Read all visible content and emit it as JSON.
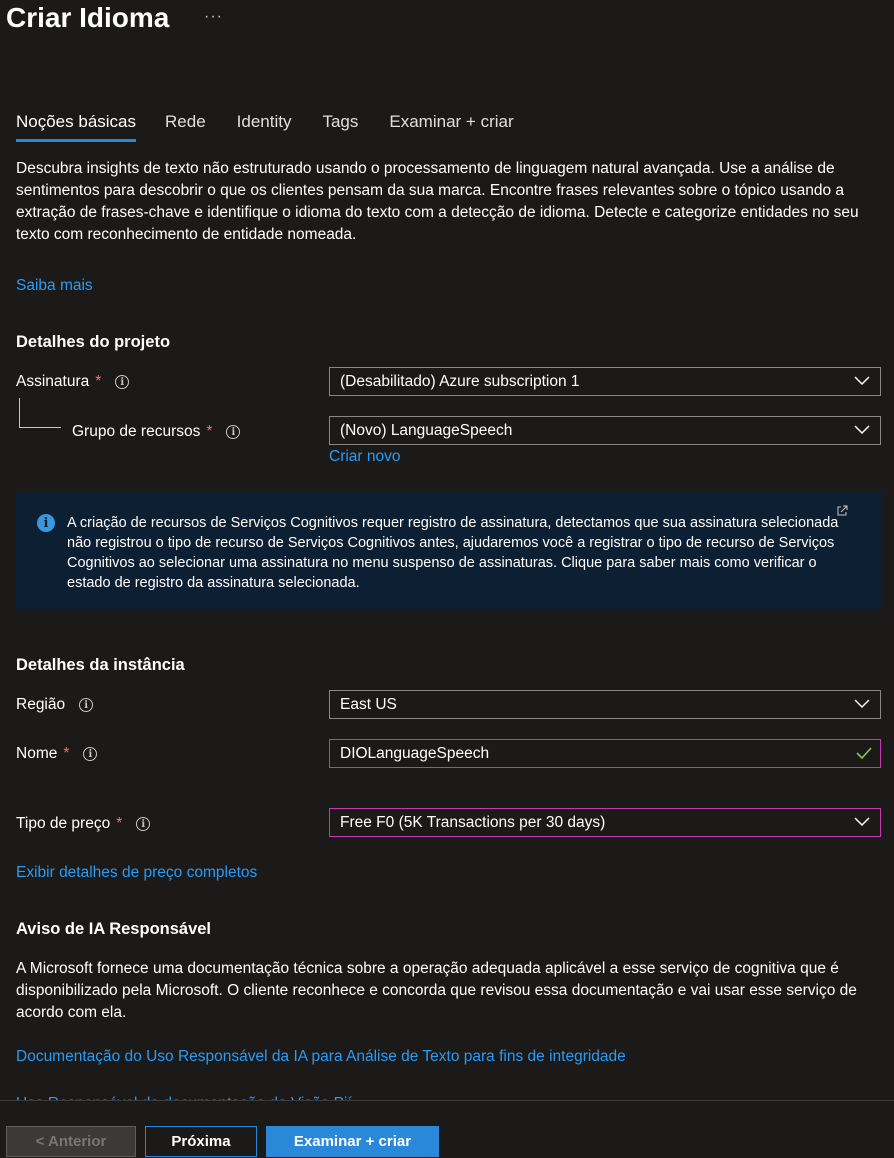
{
  "page": {
    "title": "Criar Idioma",
    "more_label": "···"
  },
  "tabs": [
    {
      "label": "Noções básicas",
      "active": true
    },
    {
      "label": "Rede",
      "active": false
    },
    {
      "label": "Identity",
      "active": false
    },
    {
      "label": "Tags",
      "active": false
    },
    {
      "label": "Examinar + criar",
      "active": false
    }
  ],
  "intro": {
    "text": "Descubra insights de texto não estruturado usando o processamento de linguagem natural avançada. Use a análise de sentimentos para descobrir o que os clientes pensam da sua marca. Encontre frases relevantes sobre o tópico usando a extração de frases-chave e identifique o idioma do texto com a detecção de idioma. Detecte e categorize entidades no seu texto com reconhecimento de entidade nomeada.",
    "learn_more": "Saiba mais"
  },
  "project": {
    "heading": "Detalhes do projeto",
    "subscription": {
      "label": "Assinatura",
      "required": "*",
      "value": "(Desabilitado) Azure subscription 1"
    },
    "resource_group": {
      "label": "Grupo de recursos",
      "required": "*",
      "value": "(Novo) LanguageSpeech",
      "create_new": "Criar novo"
    }
  },
  "banner": {
    "text": "A criação de recursos de Serviços Cognitivos requer registro de assinatura, detectamos que sua assinatura selecionada não registrou o tipo de recurso de Serviços Cognitivos antes, ajudaremos você a registrar o tipo de recurso de Serviços Cognitivos ao selecionar uma assinatura no menu suspenso de assinaturas. Clique para saber mais como verificar o estado de registro da assinatura selecionada."
  },
  "instance": {
    "heading": "Detalhes da instância",
    "region": {
      "label": "Região",
      "value": "East US"
    },
    "name": {
      "label": "Nome",
      "required": "*",
      "value": "DIOLanguageSpeech"
    },
    "pricing": {
      "label": "Tipo de preço",
      "required": "*",
      "value": "Free F0 (5K Transactions per 30 days)"
    },
    "pricing_link": "Exibir detalhes de preço completos"
  },
  "responsible_ai": {
    "heading": "Aviso de IA Responsável",
    "text": "A Microsoft fornece uma documentação técnica sobre a operação adequada aplicável a esse serviço de cognitiva que é disponibilizado pela Microsoft. O cliente reconhece e concorda que revisou essa documentação e vai usar esse serviço de acordo com ela.",
    "doc_link": "Documentação do Uso Responsável da IA para Análise de Texto para fins de integridade",
    "cut_link": "Uso Responsável da documentação da Visão Pií"
  },
  "footer": {
    "prev": "< Anterior",
    "next": "Próxima",
    "review": "Examinar + criar"
  },
  "colors": {
    "accent": "#2b88d8",
    "link": "#2b9af3",
    "required": "#f1707b",
    "valid": "#92c353",
    "focus_border": "#c239b3"
  }
}
